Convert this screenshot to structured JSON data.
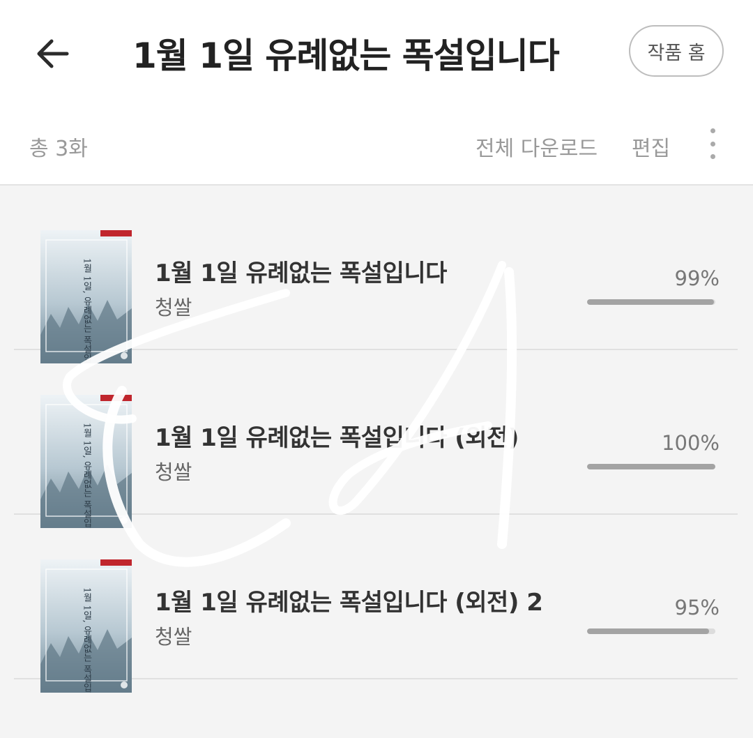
{
  "header": {
    "title": "1월 1일 유례없는 폭설입니다",
    "back_icon": "arrow-left-icon",
    "home_label": "작품 홈"
  },
  "toolbar": {
    "total_label": "총 3화",
    "download_all_label": "전체 다운로드",
    "edit_label": "편집",
    "more_icon": "more-vertical-icon"
  },
  "books": [
    {
      "title": "1월 1일 유례없는 폭설입니다",
      "author": "청쌀",
      "progress_label": "99%",
      "progress": 0.99
    },
    {
      "title": "1월 1일 유례없는 폭설입니다 (외전)",
      "author": "청쌀",
      "progress_label": "100%",
      "progress": 1.0
    },
    {
      "title": "1월 1일 유례없는 폭설입니다 (외전) 2",
      "author": "청쌀",
      "progress_label": "95%",
      "progress": 0.95
    }
  ],
  "cover": {
    "title_text": "1월 1일, 유례없는 폭설입니다",
    "badge_color": "#c0262d"
  },
  "colors": {
    "background": "#f4f4f4",
    "header_bg": "#ffffff",
    "progress_fill": "#a3a3a3",
    "progress_track": "#dcdcdc"
  }
}
